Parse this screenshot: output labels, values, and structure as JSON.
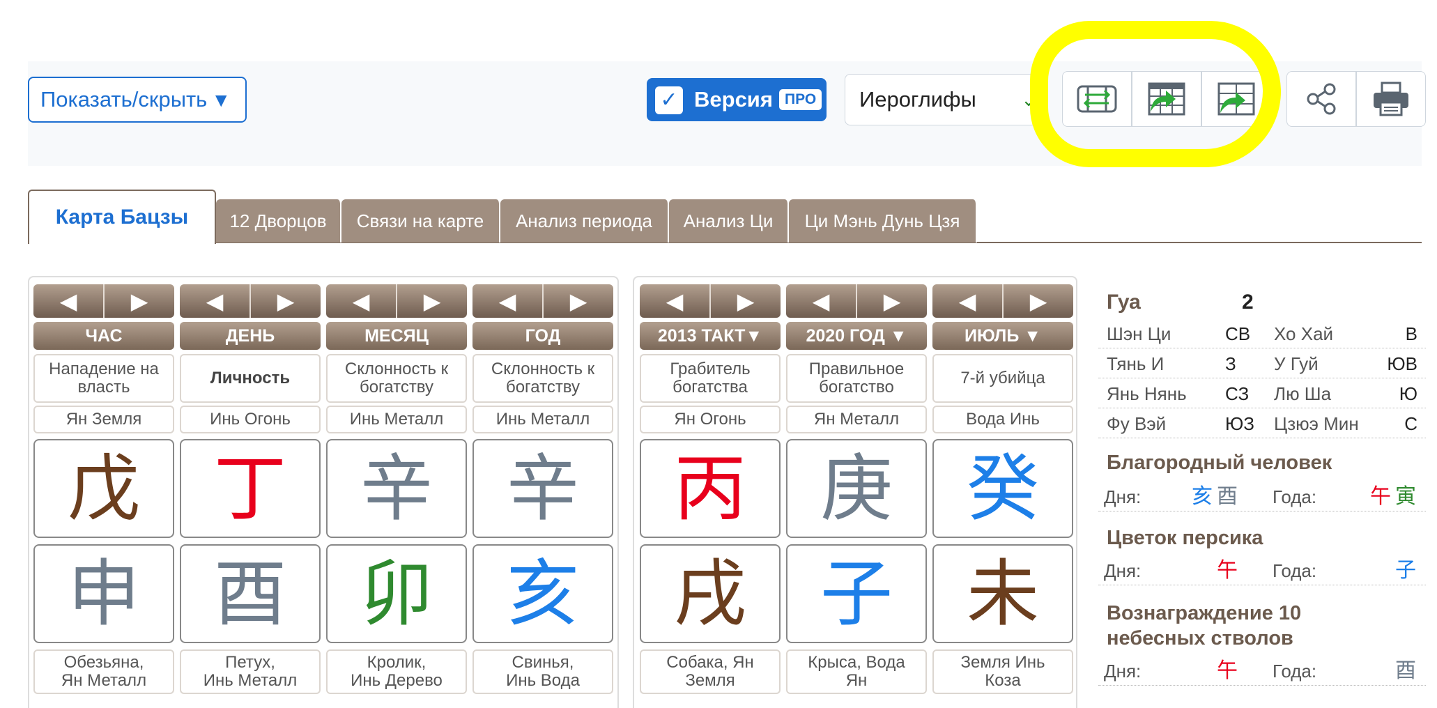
{
  "toolbar": {
    "show_hide": "Показать/скрыть",
    "show_hide_arrow": "▼",
    "version_label": "Версия",
    "version_badge": "ПРО",
    "check": "✓",
    "select_value": "Иероглифы",
    "select_chevron": "⌄",
    "icons": [
      "swap-table-icon",
      "export-calendar-icon",
      "export-grid-icon",
      "share-icon",
      "print-icon"
    ]
  },
  "tabs": [
    "Карта Бацзы",
    "12 Дворцов",
    "Связи на карте",
    "Анализ периода",
    "Анализ Ци",
    "Ци Мэнь Дунь Цзя"
  ],
  "arrows": {
    "left": "◀",
    "right": "▶"
  },
  "pillars": [
    {
      "header": "ЧАС",
      "relation": "Нападение на власть",
      "element": "Ян Земля",
      "stem": "戊",
      "branch": "申",
      "animal_line1": "Обезьяна,",
      "animal_line2": "Ян Металл"
    },
    {
      "header": "ДЕНЬ",
      "relation": "Личность",
      "element": "Инь Огонь",
      "stem": "丁",
      "branch": "酉",
      "animal_line1": "Петух,",
      "animal_line2": "Инь Металл"
    },
    {
      "header": "МЕСЯЦ",
      "relation": "Склонность к богатству",
      "element": "Инь Металл",
      "stem": "辛",
      "branch": "卯",
      "animal_line1": "Кролик,",
      "animal_line2": "Инь Дерево"
    },
    {
      "header": "ГОД",
      "relation": "Склонность к богатству",
      "element": "Инь Металл",
      "stem": "辛",
      "branch": "亥",
      "animal_line1": "Свинья,",
      "animal_line2": "Инь Вода"
    }
  ],
  "periods": [
    {
      "header": "2013 ТАКТ▼",
      "relation": "Грабитель богатства",
      "element": "Ян Огонь",
      "stem": "丙",
      "branch": "戌",
      "animal_line1": "Собака, Ян",
      "animal_line2": "Земля"
    },
    {
      "header": "2020 ГОД ▼",
      "relation": "Правильное богатство",
      "element": "Ян Металл",
      "stem": "庚",
      "branch": "子",
      "animal_line1": "Крыса, Вода",
      "animal_line2": "Ян"
    },
    {
      "header": "ИЮЛЬ ▼",
      "relation": "7-й убийца",
      "element": "Вода Инь",
      "stem": "癸",
      "branch": "未",
      "animal_line1": "Земля Инь",
      "animal_line2": "Коза"
    }
  ],
  "side": {
    "gua_label": "Гуа",
    "gua_value": "2",
    "directions": [
      [
        "Шэн Ци",
        "СВ",
        "Хо Хай",
        "В"
      ],
      [
        "Тянь И",
        "З",
        "У Гуй",
        "ЮВ"
      ],
      [
        "Янь Нянь",
        "СЗ",
        "Лю Ша",
        "Ю"
      ],
      [
        "Фу Вэй",
        "ЮЗ",
        "Цзюэ Мин",
        "С"
      ]
    ],
    "noble_title": "Благородный человек",
    "noble": {
      "day_label": "Дня:",
      "day_1": "亥",
      "day_2": "酉",
      "year_label": "Года:",
      "year_1": "午",
      "year_2": "寅"
    },
    "peach_title": "Цветок персика",
    "peach": {
      "day_label": "Дня:",
      "day": "午",
      "year_label": "Года:",
      "year": "子"
    },
    "reward_title_line1": "Вознаграждение 10",
    "reward_title_line2": "небесных стволов",
    "reward": {
      "day_label": "Дня:",
      "day": "午",
      "year_label": "Года:",
      "year": "酉"
    }
  },
  "colors": {
    "accent": "#1d6fd1",
    "fire": "#e8001c",
    "earth": "#6b3e1e",
    "metal": "#6f7d8c",
    "wood": "#2f8a2f",
    "water": "#1d7fe8",
    "highlight": "#ffff00"
  }
}
